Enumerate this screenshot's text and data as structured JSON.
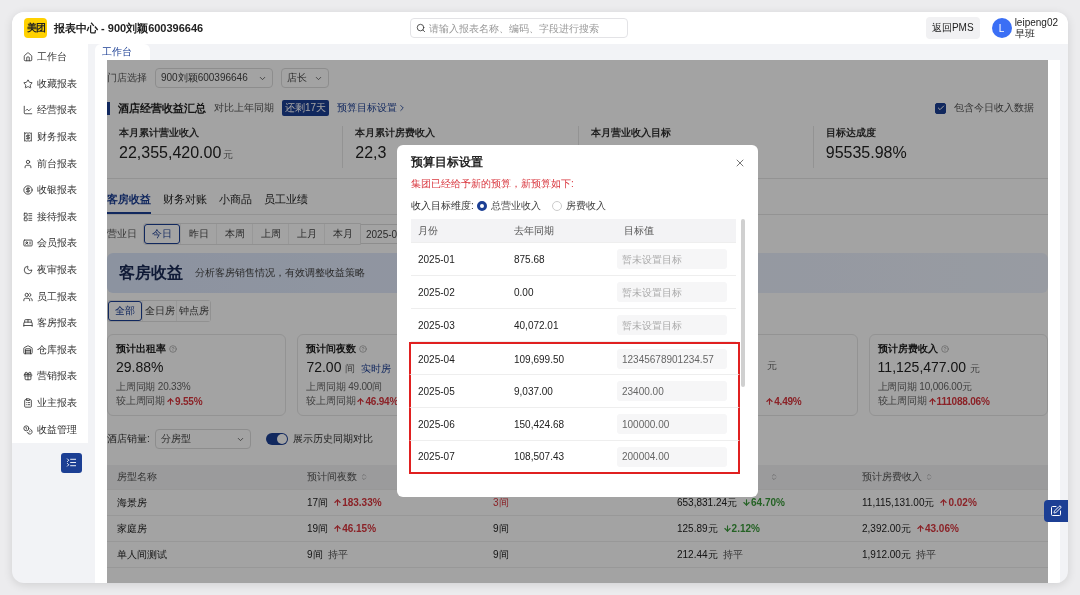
{
  "header": {
    "logo": "美团",
    "title": "报表中心 - 900刘颖600396646",
    "search_placeholder": "请输入报表名称、编码、字段进行搜索",
    "back_button": "返回PMS",
    "user": {
      "avatar": "L",
      "name": "leipeng02",
      "shift": "早班"
    }
  },
  "sidebar": {
    "items": [
      {
        "label": "工作台"
      },
      {
        "label": "收藏报表"
      },
      {
        "label": "经营报表"
      },
      {
        "label": "财务报表"
      },
      {
        "label": "前台报表"
      },
      {
        "label": "收银报表"
      },
      {
        "label": "接待报表"
      },
      {
        "label": "会员报表"
      },
      {
        "label": "夜审报表"
      },
      {
        "label": "员工报表"
      },
      {
        "label": "客房报表"
      },
      {
        "label": "仓库报表"
      },
      {
        "label": "营销报表"
      },
      {
        "label": "业主报表"
      },
      {
        "label": "收益管理"
      }
    ]
  },
  "page_tabs": [
    {
      "label": "工作台",
      "selected": true
    }
  ],
  "filters": {
    "store_label": "门店选择",
    "store": "900刘颖600396646",
    "role": "店长"
  },
  "summary": {
    "title": "酒店经营收益汇总",
    "compare": "对比上年同期",
    "badge": "还剩17天",
    "link": "预算目标设置",
    "include_today": {
      "label": "包含今日收入数据",
      "checked": true
    },
    "kpis": [
      {
        "label": "本月累计营业收入",
        "value": "22,355,420.00",
        "unit": "元"
      },
      {
        "label": "本月累计房费收入",
        "value": "22,3"
      },
      {
        "label": "本月营业收入目标"
      },
      {
        "label": "目标达成度",
        "value": "95535.98%"
      }
    ]
  },
  "report_tabs": [
    {
      "label": "客房收益",
      "selected": true
    },
    {
      "label": "财务对账",
      "selected": false
    },
    {
      "label": "小商品",
      "selected": false
    },
    {
      "label": "员工业绩",
      "selected": false
    }
  ],
  "date_filter": {
    "label": "营业日",
    "options": [
      {
        "label": "今日",
        "selected": true
      },
      {
        "label": "昨日",
        "selected": false
      },
      {
        "label": "本周",
        "selected": false
      },
      {
        "label": "上周",
        "selected": false
      },
      {
        "label": "上月",
        "selected": false
      },
      {
        "label": "本月",
        "selected": false
      }
    ],
    "date": "2025-0"
  },
  "banner": {
    "title": "客房收益",
    "subtitle": "分析客房销售情况，有效调整收益策略"
  },
  "room_types": [
    {
      "label": "全部",
      "selected": true
    },
    {
      "label": "全日房",
      "selected": false
    },
    {
      "label": "钟点房",
      "selected": false
    }
  ],
  "metrics": [
    {
      "title": "预计出租率",
      "value": "29.88%",
      "last_week": "上周同期 20.33%",
      "change_label": "较上周同期",
      "change": "9.55%",
      "kind": "up"
    },
    {
      "title": "预计间夜数",
      "value": "72.00",
      "unit": "间",
      "link": "实时房",
      "last_week": "上周同期 49.00间",
      "change_label": "较上周同期",
      "change": "46.94%",
      "kind": "up"
    },
    {
      "unit": "元",
      "change": "4.49%",
      "kind": "up"
    },
    {
      "title": "预计房费收入",
      "value": "11,125,477.00",
      "unit": "元",
      "last_week": "上周同期 10,006.00元",
      "change_label": "较上周同期",
      "change": "111088.06%",
      "kind": "up"
    }
  ],
  "sales_filter": {
    "label": "酒店销量:",
    "value": "分房型",
    "toggle": {
      "label": "展示历史同期对比",
      "on": true
    }
  },
  "table": {
    "columns": [
      {
        "label": "房型名称",
        "sortable": false
      },
      {
        "label": "预计间夜数",
        "sortable": true
      },
      "",
      {
        "sortable": true
      },
      {
        "label": "预计房费收入",
        "sortable": true
      }
    ],
    "rows": [
      [
        {
          "text": "海景房"
        },
        {
          "text": "17间",
          "change": "183.33%",
          "kind": "up"
        },
        {
          "text": "3间",
          "flagged": true
        },
        {
          "text": "653,831.24元",
          "change": "64.70%",
          "kind": "down"
        },
        {
          "text": "11,115,131.00元",
          "change": "0.02%",
          "kind": "up"
        }
      ],
      [
        {
          "text": "家庭房"
        },
        {
          "text": "19间",
          "change": "46.15%",
          "kind": "up"
        },
        {
          "text": "9间",
          "flagged": false
        },
        {
          "text": "125.89元",
          "change": "2.12%",
          "kind": "down"
        },
        {
          "text": "2,392.00元",
          "change": "43.06%",
          "kind": "up"
        }
      ],
      [
        {
          "text": "单人间测试"
        },
        {
          "text": "9间",
          "change": "持平",
          "kind": "flat"
        },
        {
          "text": "9间",
          "flagged": false
        },
        {
          "text": "212.44元",
          "change": "持平",
          "kind": "flat"
        },
        {
          "text": "1,912.00元",
          "change": "持平",
          "kind": "flat"
        }
      ]
    ]
  },
  "modal": {
    "title": "预算目标设置",
    "notice": "集团已经给予新的预算，新预算如下:",
    "dimension": {
      "label": "收入目标维度:",
      "options": [
        {
          "label": "总营业收入",
          "selected": true
        },
        {
          "label": "房费收入",
          "selected": false
        }
      ]
    },
    "columns": [
      "月份",
      "去年同期",
      "目标值"
    ],
    "rows": [
      {
        "month": "2025-01",
        "last_year": "875.68",
        "placeholder": "暂未设置目标",
        "highlighted": false
      },
      {
        "month": "2025-02",
        "last_year": "0.00",
        "placeholder": "暂未设置目标",
        "highlighted": false
      },
      {
        "month": "2025-03",
        "last_year": "40,072.01",
        "placeholder": "暂未设置目标",
        "highlighted": false
      },
      {
        "month": "2025-04",
        "last_year": "109,699.50",
        "target": "12345678901234.57",
        "highlighted": true
      },
      {
        "month": "2025-05",
        "last_year": "9,037.00",
        "target": "23400.00",
        "highlighted": true
      },
      {
        "month": "2025-06",
        "last_year": "150,424.68",
        "target": "100000.00",
        "highlighted": true
      },
      {
        "month": "2025-07",
        "last_year": "108,507.43",
        "target": "200004.00",
        "highlighted": true
      }
    ]
  }
}
